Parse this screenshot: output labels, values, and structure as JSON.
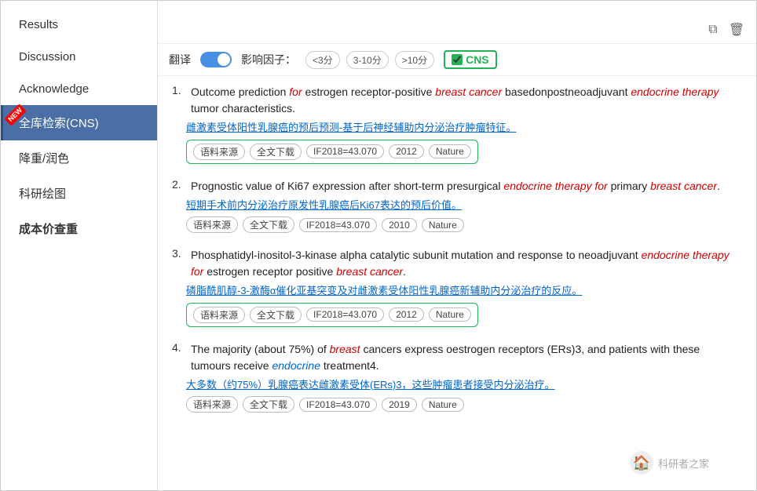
{
  "sidebar": {
    "items": [
      {
        "label": "Results",
        "active": false,
        "new": false,
        "bold": false
      },
      {
        "label": "Discussion",
        "active": false,
        "new": false,
        "bold": false
      },
      {
        "label": "Acknowledge",
        "active": false,
        "new": false,
        "bold": false
      },
      {
        "label": "全库检索(CNS)",
        "active": true,
        "new": true,
        "bold": false
      },
      {
        "label": "降重/润色",
        "active": false,
        "new": false,
        "bold": false
      },
      {
        "label": "科研绘图",
        "active": false,
        "new": false,
        "bold": false
      },
      {
        "label": "成本价查重",
        "active": false,
        "new": false,
        "bold": true
      }
    ]
  },
  "filter": {
    "translate_label": "翻译",
    "impact_label": "影响因子：",
    "options": [
      "<3分",
      "3-10分",
      ">10分"
    ],
    "cns_label": "CNS"
  },
  "results": [
    {
      "num": "1.",
      "title_parts": [
        {
          "text": "Outcome prediction ",
          "style": "normal"
        },
        {
          "text": "for",
          "style": "italic-red"
        },
        {
          "text": " estrogen receptor-positive ",
          "style": "normal"
        },
        {
          "text": "breast cancer",
          "style": "italic-red"
        },
        {
          "text": " basedonpostneoadjuvant ",
          "style": "normal"
        },
        {
          "text": "endocrine therapy",
          "style": "italic-red"
        },
        {
          "text": " tumor characteristics.",
          "style": "normal"
        }
      ],
      "chinese": "雌激素受体阳性乳腺癌的预后预测-基于后神经辅助内分泌治疗肿瘤特征。",
      "tags": [
        "语料来源",
        "全文下载",
        "IF2018=43.070",
        "2012",
        "Nature"
      ],
      "tags_bordered": true
    },
    {
      "num": "2.",
      "title_parts": [
        {
          "text": "Prognostic value of Ki67 expression after short-term presurgical ",
          "style": "normal"
        },
        {
          "text": "endocrine therapy for",
          "style": "italic-red"
        },
        {
          "text": " primary ",
          "style": "normal"
        },
        {
          "text": "breast cancer",
          "style": "italic-red"
        },
        {
          "text": ".",
          "style": "normal"
        }
      ],
      "chinese": "短期手术前内分泌治疗原发性乳腺癌后Ki67表达的预后价值。",
      "tags": [
        "语料来源",
        "全文下载",
        "IF2018=43.070",
        "2010",
        "Nature"
      ],
      "tags_bordered": false
    },
    {
      "num": "3.",
      "title_parts": [
        {
          "text": "Phosphatidyl-inositol-3-kinase alpha catalytic subunit mutation and response to neoadjuvant ",
          "style": "normal"
        },
        {
          "text": "endocrine therapy for",
          "style": "italic-red"
        },
        {
          "text": " estrogen receptor positive ",
          "style": "normal"
        },
        {
          "text": "breast cancer",
          "style": "italic-red"
        },
        {
          "text": ".",
          "style": "normal"
        }
      ],
      "chinese": "磷脂酰肌醇-3-激酶α催化亚基突变及对雌激素受体阳性乳腺癌新辅助内分泌治疗的反应。",
      "tags": [
        "语料来源",
        "全文下载",
        "IF2018=43.070",
        "2012",
        "Nature"
      ],
      "tags_bordered": true
    },
    {
      "num": "4.",
      "title_parts": [
        {
          "text": "The majority (about 75%) of ",
          "style": "normal"
        },
        {
          "text": "breast",
          "style": "italic-red"
        },
        {
          "text": " cancers express oestrogen receptors (ERs)3, and patients with these tumours receive ",
          "style": "normal"
        },
        {
          "text": "endocrine",
          "style": "italic-blue"
        },
        {
          "text": " treatment4.",
          "style": "normal"
        }
      ],
      "chinese": "大多数（约75%）乳腺癌表达雌激素受体(ERs)3，这些肿瘤患者接受内分泌治疗。",
      "tags": [
        "语料来源",
        "全文下载",
        "IF2018=43.070",
        "2019",
        "Nature"
      ],
      "tags_bordered": false
    }
  ],
  "watermark": {
    "text": "科研者之家"
  }
}
